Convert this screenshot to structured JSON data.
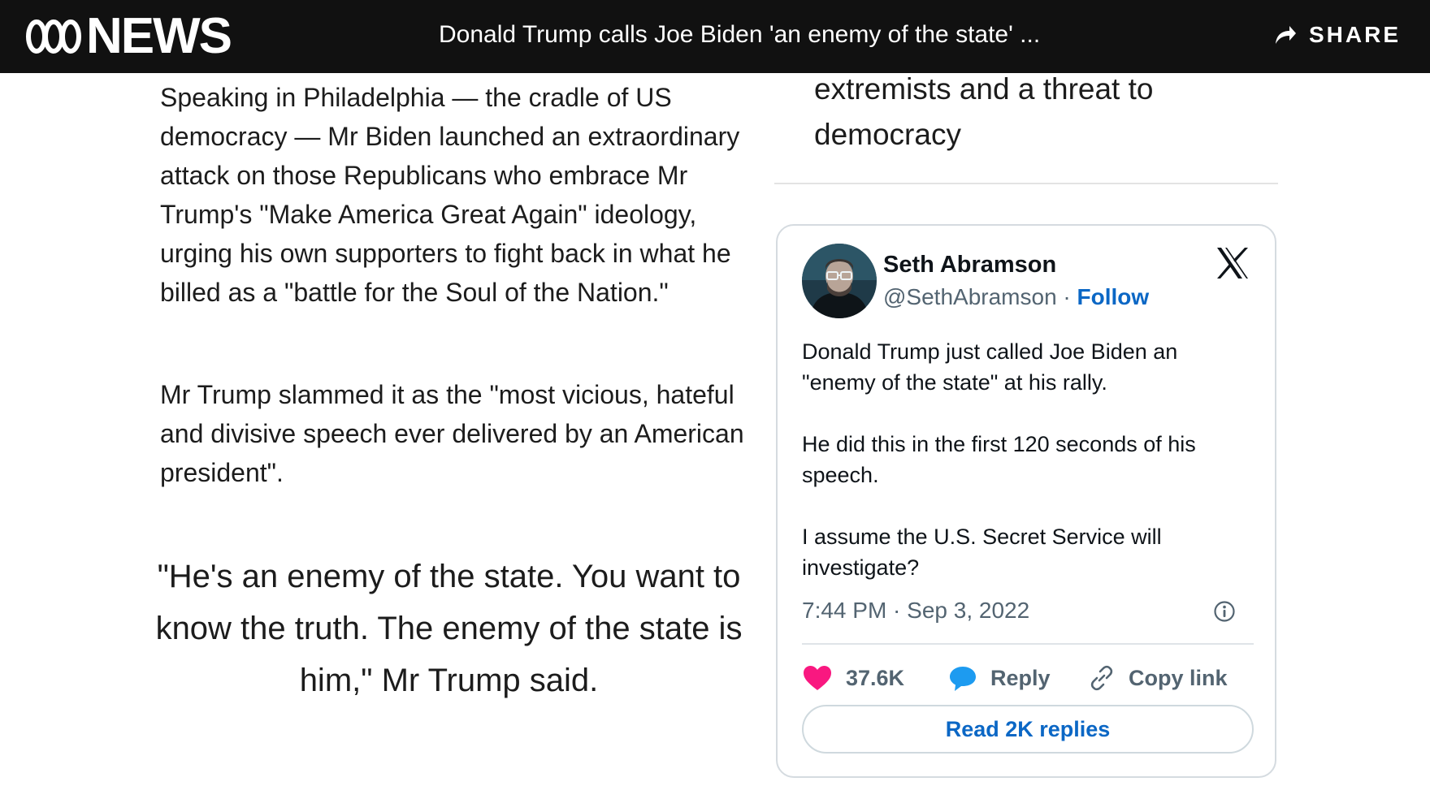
{
  "header": {
    "logo_text": "NEWS",
    "headline": "Donald Trump calls Joe Biden 'an enemy of the state' ...",
    "share_label": "SHARE"
  },
  "article": {
    "paragraphs": [
      "Speaking in Philadelphia — the cradle of US democracy — Mr Biden launched an extraordinary attack on those Republicans who embrace Mr Trump's \"Make America Great Again\" ideology, urging his own supporters to fight back in what he billed as a \"battle for the Soul of the Nation.\"",
      "Mr Trump slammed it as the \"most vicious, hateful and divisive speech ever delivered by an American president\"."
    ],
    "quote": "\"He's an enemy of the state. You want to know the truth. The enemy of the state is him,\" Mr Trump said."
  },
  "pull_quote": "extremists and a threat to democracy",
  "tweet": {
    "author_name": "Seth Abramson",
    "handle": "@SethAbramson",
    "separator": " · ",
    "follow_label": "Follow",
    "paragraphs": [
      "Donald Trump just called Joe Biden an \"enemy of the state\" at his rally.",
      "He did this in the first 120 seconds of his speech.",
      "I assume the U.S. Secret Service will investigate?"
    ],
    "timestamp": "7:44 PM · Sep 3, 2022",
    "likes_count": "37.6K",
    "reply_label": "Reply",
    "copy_link_label": "Copy link",
    "read_replies_label": "Read 2K replies"
  },
  "colors": {
    "header_bg": "#111111",
    "link_blue": "#0b67c5",
    "like_pink": "#f91880",
    "reply_blue": "#1d9bf0",
    "muted_gray": "#536471"
  },
  "icons": {
    "share": "share-arrow-icon",
    "x_logo": "x-logo-icon",
    "info": "info-icon",
    "like": "heart-icon",
    "reply": "speech-bubble-icon",
    "copy": "link-icon"
  }
}
